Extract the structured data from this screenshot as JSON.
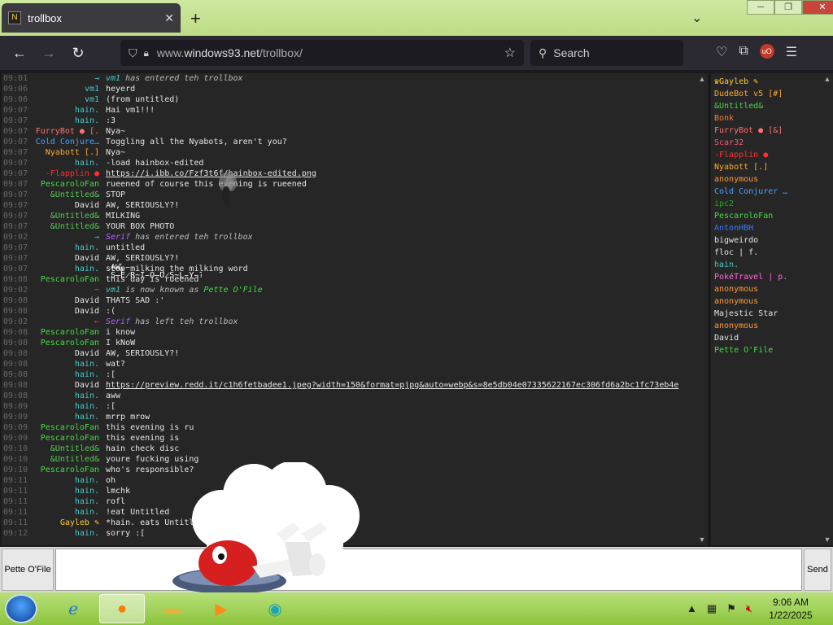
{
  "browser": {
    "tab_title": "trollbox",
    "tab_favicon": "N",
    "new_tab_glyph": "+",
    "url_prefix": "www.",
    "url_domain": "windows93.net",
    "url_path": "/trollbox/",
    "search_placeholder": "Search",
    "ublock_badge": "uO"
  },
  "chat": {
    "messages": [
      {
        "ts": "09:01",
        "nick": "→",
        "nick_color": "#4ac8c8",
        "text": "",
        "sys_nick": "vm1",
        "sys_nick_color": "#4ac8c8",
        "sys_text": " has entered teh trollbox"
      },
      {
        "ts": "09:06",
        "nick": "vm1",
        "nick_color": "#4ac8c8",
        "text": "heyerd"
      },
      {
        "ts": "09:06",
        "nick": "vm1",
        "nick_color": "#4ac8c8",
        "text": "(from untitled)"
      },
      {
        "ts": "09:07",
        "nick": "hain.",
        "nick_color": "#4ac8c8",
        "text": "Hai vm1!!!"
      },
      {
        "ts": "09:07",
        "nick": "hain.",
        "nick_color": "#4ac8c8",
        "text": ":3"
      },
      {
        "ts": "09:07",
        "nick": "FurryBot ● [.",
        "nick_color": "#ff7070",
        "text": "Nya~"
      },
      {
        "ts": "09:07",
        "nick": "Cold Conjure…",
        "nick_color": "#4aa0ff",
        "text": "Toggling all the Nyabots, aren't you?"
      },
      {
        "ts": "09:07",
        "nick": "Nyabott [.]",
        "nick_color": "#ffaa33",
        "text": "Nya~"
      },
      {
        "ts": "09:07",
        "nick": "hain.",
        "nick_color": "#4ac8c8",
        "text": "-load hainbox-edited"
      },
      {
        "ts": "09:07",
        "nick": "-Flapplin ●",
        "nick_color": "#ff3030",
        "text": "",
        "link": "https://i.ibb.co/Fzf3t6f/hainbox-edited.png"
      },
      {
        "ts": "09:07",
        "nick": "PescaroloFan",
        "nick_color": "#44dd44",
        "text": "rueened of course this evening is rueened"
      },
      {
        "ts": "09:07",
        "nick": "&Untitled&",
        "nick_color": "#55cc55",
        "text": "STOP"
      },
      {
        "ts": "09:07",
        "nick": "David",
        "nick_color": "#e6e6e6",
        "text": "AW, SERIOUSLY?!"
      },
      {
        "ts": "09:07",
        "nick": "&Untitled&",
        "nick_color": "#55cc55",
        "text": "MILKING"
      },
      {
        "ts": "09:07",
        "nick": "&Untitled&",
        "nick_color": "#55cc55",
        "text": "YOUR BOX PHOTO"
      },
      {
        "ts": "09:02",
        "nick": "→",
        "nick_color": "#4ac8c8",
        "text": "",
        "sys_nick": "Serif",
        "sys_nick_color": "#b060ff",
        "sys_text": " has entered teh trollbox"
      },
      {
        "ts": "09:07",
        "nick": "hain.",
        "nick_color": "#4ac8c8",
        "text": "untitled"
      },
      {
        "ts": "09:07",
        "nick": "David",
        "nick_color": "#e6e6e6",
        "text": "AW, SERIOUSLY?!"
      },
      {
        "ts": "09:07",
        "nick": "hain.",
        "nick_color": "#4ac8c8",
        "text": "stop milking the milking word"
      },
      {
        "ts": "09:08",
        "nick": "PescaroloFan",
        "nick_color": "#44dd44",
        "text": "this day is rueened"
      },
      {
        "ts": "09:02",
        "nick": "~",
        "nick_color": "#888888",
        "text": "",
        "sys_nick": "vm1",
        "sys_nick_color": "#4ac8c8",
        "sys_text": " is now known as ",
        "sys_nick2": "Pette O'File",
        "sys_nick2_color": "#44dd44"
      },
      {
        "ts": "09:08",
        "nick": "David",
        "nick_color": "#e6e6e6",
        "text": "THATS SAD :'"
      },
      {
        "ts": "09:08",
        "nick": "David",
        "nick_color": "#e6e6e6",
        "text": ":("
      },
      {
        "ts": "09:02",
        "nick": "←",
        "nick_color": "#ff3030",
        "text": "",
        "sys_nick": "Serif",
        "sys_nick_color": "#b060ff",
        "sys_text": " has left teh trollbox"
      },
      {
        "ts": "09:08",
        "nick": "PescaroloFan",
        "nick_color": "#44dd44",
        "text": "i know"
      },
      {
        "ts": "09:08",
        "nick": "PescaroloFan",
        "nick_color": "#44dd44",
        "text": "I kNoW"
      },
      {
        "ts": "09:08",
        "nick": "David",
        "nick_color": "#e6e6e6",
        "text": "AW, SERIOUSLY?!"
      },
      {
        "ts": "09:08",
        "nick": "hain.",
        "nick_color": "#4ac8c8",
        "text": "wat?"
      },
      {
        "ts": "09:08",
        "nick": "hain.",
        "nick_color": "#4ac8c8",
        "text": ":["
      },
      {
        "ts": "09:08",
        "nick": "David",
        "nick_color": "#e6e6e6",
        "text": "",
        "link": "https://preview.redd.it/c1h6fetbadee1.jpeg?width=150&format=pjpg&auto=webp&s=8e5db04e07335622167ec306fd6a2bc1fc73eb4e"
      },
      {
        "ts": "09:08",
        "nick": "hain.",
        "nick_color": "#4ac8c8",
        "text": "aww"
      },
      {
        "ts": "09:09",
        "nick": "hain.",
        "nick_color": "#4ac8c8",
        "text": ":["
      },
      {
        "ts": "09:09",
        "nick": "hain.",
        "nick_color": "#4ac8c8",
        "text": "mrrp mrow"
      },
      {
        "ts": "09:09",
        "nick": "PescaroloFan",
        "nick_color": "#44dd44",
        "text": "this evening is ru"
      },
      {
        "ts": "09:09",
        "nick": "PescaroloFan",
        "nick_color": "#44dd44",
        "text": "this evening is"
      },
      {
        "ts": "09:10",
        "nick": "&Untitled&",
        "nick_color": "#55cc55",
        "text": "hain check disc"
      },
      {
        "ts": "09:10",
        "nick": "&Untitled&",
        "nick_color": "#55cc55",
        "text": "youre fucking using"
      },
      {
        "ts": "09:10",
        "nick": "PescaroloFan",
        "nick_color": "#44dd44",
        "text": "who's responsible?"
      },
      {
        "ts": "09:11",
        "nick": "hain.",
        "nick_color": "#4ac8c8",
        "text": "oh"
      },
      {
        "ts": "09:11",
        "nick": "hain.",
        "nick_color": "#4ac8c8",
        "text": "lmchk"
      },
      {
        "ts": "09:11",
        "nick": "hain.",
        "nick_color": "#4ac8c8",
        "text": "rofl"
      },
      {
        "ts": "09:11",
        "nick": "hain.",
        "nick_color": "#4ac8c8",
        "text": "!eat Untitled"
      },
      {
        "ts": "09:11",
        "nick": "Gayleb ✎",
        "nick_color": "#ffcc33",
        "text": "*hain. eats Untitled*"
      },
      {
        "ts": "09:12",
        "nick": "hain.",
        "nick_color": "#4ac8c8",
        "text": "sorry :["
      }
    ],
    "glitch_text": "A̴̱͠W̶͉͂,̵ S̶E̷R̴I̵O̶U̷S̴L̵Y̵?̴!̵"
  },
  "users": [
    {
      "name": "♛Gayleb ✎",
      "color": "#ffcc33"
    },
    {
      "name": "DudeBot v5 [#]",
      "color": "#ffaa33"
    },
    {
      "name": "&Untitled&",
      "color": "#55cc55"
    },
    {
      "name": "Bonk",
      "color": "#ff7733"
    },
    {
      "name": "FurryBot ● [&]",
      "color": "#ff7070"
    },
    {
      "name": "Scar32",
      "color": "#ff5577"
    },
    {
      "name": "-Flapplin ●",
      "color": "#ff3030"
    },
    {
      "name": "Nyabott [.]",
      "color": "#ffaa33"
    },
    {
      "name": "anonymous",
      "color": "#ff9933"
    },
    {
      "name": "Cold Conjurer …",
      "color": "#4aa0ff"
    },
    {
      "name": "ipc2",
      "color": "#22aa22"
    },
    {
      "name": "PescaroloFan",
      "color": "#44dd44"
    },
    {
      "name": "AntonHBH",
      "color": "#3377ff"
    },
    {
      "name": "bigweirdo",
      "color": "#e6e6e6"
    },
    {
      "name": "floc | f.",
      "color": "#e6e6e6"
    },
    {
      "name": "hain.",
      "color": "#4ac8c8"
    },
    {
      "name": "PokéTravel | p.",
      "color": "#ff66dd"
    },
    {
      "name": "anonymous",
      "color": "#ff9933"
    },
    {
      "name": "anonymous",
      "color": "#ff9933"
    },
    {
      "name": "Majestic Star",
      "color": "#e6e6e6"
    },
    {
      "name": "anonymous",
      "color": "#ff9933"
    },
    {
      "name": "David",
      "color": "#e6e6e6"
    },
    {
      "name": "Pette O'File",
      "color": "#44dd44"
    }
  ],
  "input": {
    "nick_label": "Pette O'File",
    "message_value": "",
    "send_label": "Send"
  },
  "taskbar": {
    "time": "9:06 AM",
    "date": "1/22/2025"
  }
}
